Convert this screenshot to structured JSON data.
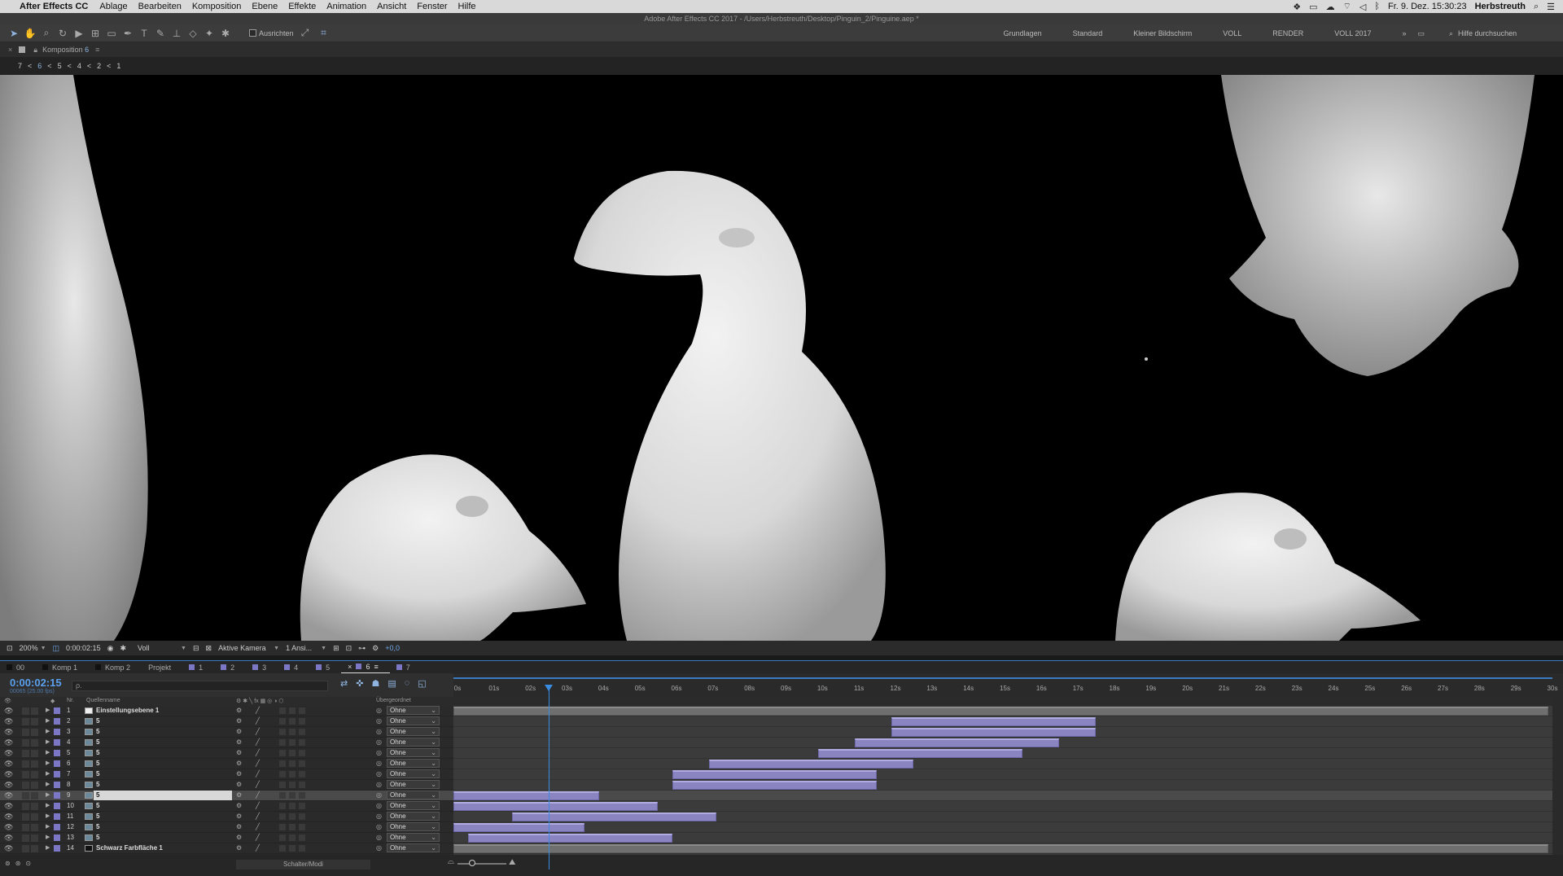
{
  "menubar": {
    "app": "After Effects CC",
    "items": [
      "Ablage",
      "Bearbeiten",
      "Komposition",
      "Ebene",
      "Effekte",
      "Animation",
      "Ansicht",
      "Fenster",
      "Hilfe"
    ],
    "datetime": "Fr. 9. Dez.  15:30:23",
    "user": "Herbstreuth"
  },
  "window_title": "Adobe After Effects CC 2017 - /Users/Herbstreuth/Desktop/Pinguin_2/Pinguine.aep *",
  "toolbar": {
    "align_label": "Ausrichten",
    "workspaces": [
      "Grundlagen",
      "Standard",
      "Kleiner Bildschirm",
      "VOLL",
      "RENDER",
      "VOLL 2017"
    ],
    "help_placeholder": "Hilfe durchsuchen"
  },
  "comp_panel": {
    "tab_label": "Komposition",
    "tab_number": "6",
    "nav": [
      "7",
      "<",
      "6",
      "<",
      "5",
      "<",
      "4",
      "<",
      "2",
      "<",
      "1"
    ]
  },
  "viewer_bar": {
    "zoom": "200%",
    "timecode": "0:00:02:15",
    "resolution": "Voll",
    "camera": "Aktive Kamera",
    "views": "1 Ansi...",
    "exposure": "+0,0"
  },
  "comp_tabs": [
    {
      "label": "00",
      "color": "#111111"
    },
    {
      "label": "Komp 1",
      "color": "#111111"
    },
    {
      "label": "Komp 2",
      "color": "#111111"
    },
    {
      "label": "Projekt",
      "color": ""
    },
    {
      "label": "1",
      "color": "#7b77c5"
    },
    {
      "label": "2",
      "color": "#7b77c5"
    },
    {
      "label": "3",
      "color": "#7b77c5"
    },
    {
      "label": "4",
      "color": "#7b77c5"
    },
    {
      "label": "5",
      "color": "#7b77c5"
    },
    {
      "label": "6",
      "color": "#7b77c5",
      "active": true
    },
    {
      "label": "7",
      "color": "#7b77c5"
    }
  ],
  "timeline": {
    "timecode": "0:00:02:15",
    "timecode_sub": "00065 (25.00 fps)",
    "search_placeholder": "ρ.",
    "ticks": [
      "0s",
      "01s",
      "02s",
      "03s",
      "04s",
      "05s",
      "06s",
      "07s",
      "08s",
      "09s",
      "10s",
      "11s",
      "12s",
      "13s",
      "14s",
      "15s",
      "16s",
      "17s",
      "18s",
      "19s",
      "20s",
      "21s",
      "22s",
      "23s",
      "24s",
      "25s",
      "26s",
      "27s",
      "28s",
      "29s",
      "30s"
    ],
    "columns": {
      "nr": "Nr.",
      "source": "Quellenname",
      "parent": "Übergeordnet"
    },
    "mode_label": "Schalter/Modi",
    "duration_s": 30,
    "playhead_s": 2.6,
    "layers": [
      {
        "nr": "1",
        "name": "Einstellungsebene 1",
        "icon": "white",
        "parent": "Ohne",
        "bar": [
          0,
          30
        ],
        "bar_style": "gray"
      },
      {
        "nr": "2",
        "name": "5",
        "icon": "comp",
        "parent": "Ohne",
        "bar": [
          12.0,
          17.6
        ]
      },
      {
        "nr": "3",
        "name": "5",
        "icon": "comp",
        "parent": "Ohne",
        "bar": [
          12.0,
          17.6
        ]
      },
      {
        "nr": "4",
        "name": "5",
        "icon": "comp",
        "parent": "Ohne",
        "bar": [
          11.0,
          16.6
        ]
      },
      {
        "nr": "5",
        "name": "5",
        "icon": "comp",
        "parent": "Ohne",
        "bar": [
          10.0,
          15.6
        ]
      },
      {
        "nr": "6",
        "name": "5",
        "icon": "comp",
        "parent": "Ohne",
        "bar": [
          7.0,
          12.6
        ]
      },
      {
        "nr": "7",
        "name": "5",
        "icon": "comp",
        "parent": "Ohne",
        "bar": [
          6.0,
          11.6
        ]
      },
      {
        "nr": "8",
        "name": "5",
        "icon": "comp",
        "parent": "Ohne",
        "bar": [
          6.0,
          11.6
        ]
      },
      {
        "nr": "9",
        "name": "5",
        "icon": "comp",
        "parent": "Ohne",
        "bar": [
          0,
          4.0
        ],
        "selected": true
      },
      {
        "nr": "10",
        "name": "5",
        "icon": "comp",
        "parent": "Ohne",
        "bar": [
          0,
          5.6
        ]
      },
      {
        "nr": "11",
        "name": "5",
        "icon": "comp",
        "parent": "Ohne",
        "bar": [
          1.6,
          7.2
        ]
      },
      {
        "nr": "12",
        "name": "5",
        "icon": "comp",
        "parent": "Ohne",
        "bar": [
          0,
          3.6
        ]
      },
      {
        "nr": "13",
        "name": "5",
        "icon": "comp",
        "parent": "Ohne",
        "bar": [
          0.4,
          6.0
        ]
      },
      {
        "nr": "14",
        "name": "Schwarz Farbfläche 1",
        "icon": "black",
        "parent": "Ohne",
        "bar": [
          0,
          30
        ],
        "bar_style": "gray"
      }
    ]
  }
}
